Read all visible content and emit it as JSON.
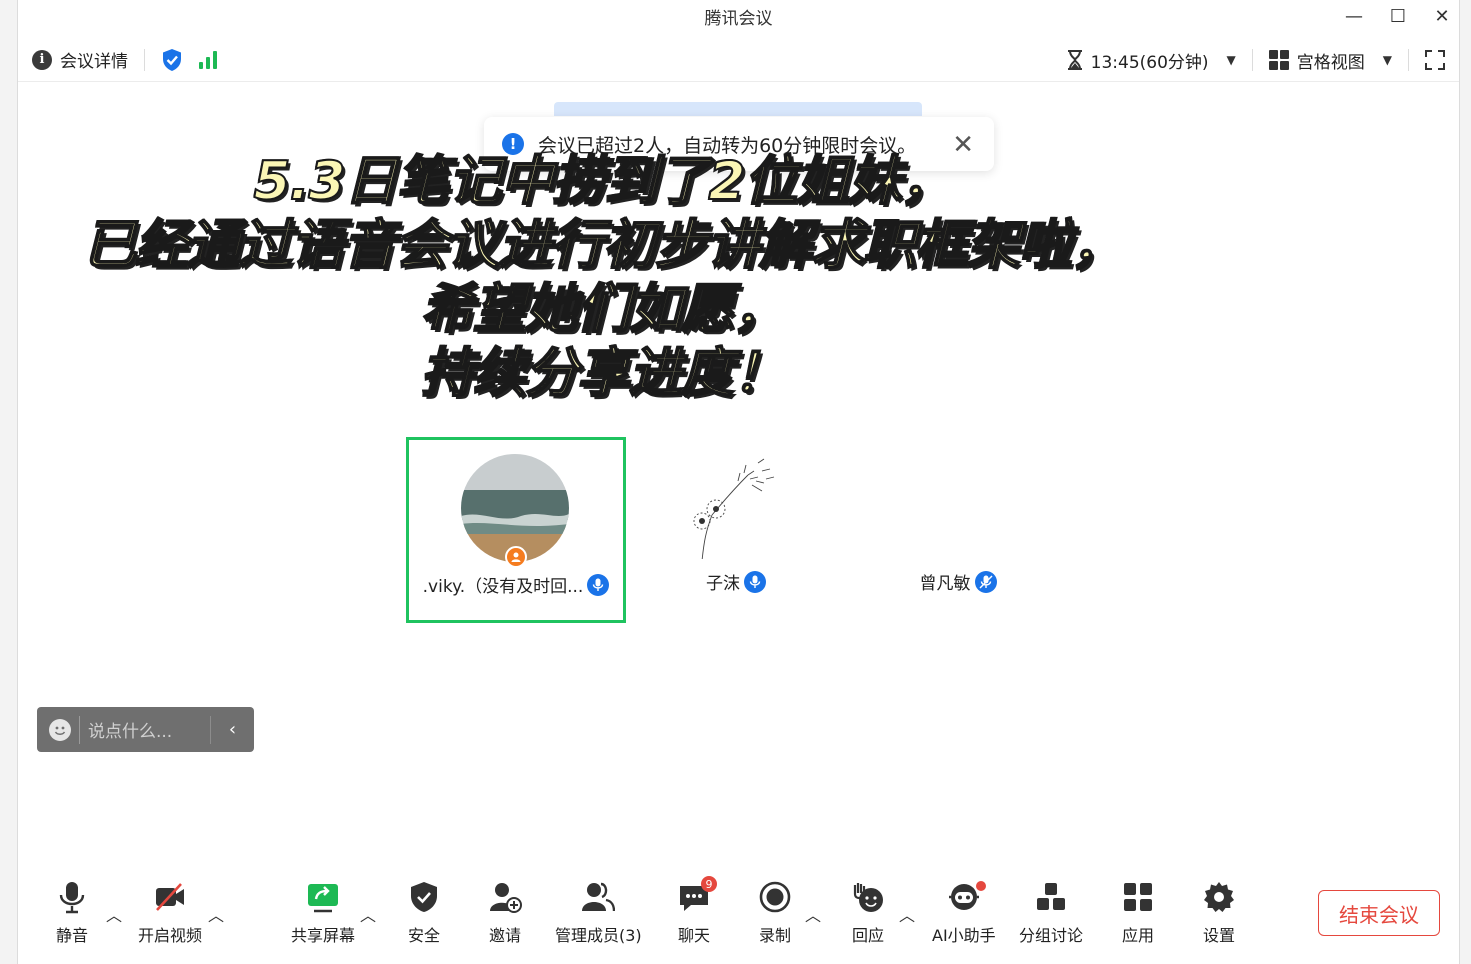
{
  "window": {
    "title": "腾讯会议"
  },
  "top_bar": {
    "meeting_details": "会议详情",
    "timer": "13:45(60分钟)",
    "view_mode": "宫格视图"
  },
  "toast": {
    "message": "会议已超过2人，自动转为60分钟限时会议。"
  },
  "overlay_text": {
    "line1": "5.3日笔记中捞到了2位姐妹，",
    "line2": "已经通过语音会议进行初步讲解求职框架啦，",
    "line3": "希望她们如愿，",
    "line4": "持续分享进度！"
  },
  "participants": [
    {
      "name": ".viky.（没有及时回...",
      "active": true
    },
    {
      "name": "子沫",
      "active": false
    },
    {
      "name": "曾凡敏",
      "active": false
    }
  ],
  "chat": {
    "placeholder": "说点什么..."
  },
  "toolbar": {
    "mute": "静音",
    "video": "开启视频",
    "share": "共享屏幕",
    "security": "安全",
    "invite": "邀请",
    "members": "管理成员(3)",
    "chat": "聊天",
    "chat_badge": "9",
    "record": "录制",
    "react": "回应",
    "ai": "AI小助手",
    "breakout": "分组讨论",
    "apps": "应用",
    "settings": "设置",
    "end": "结束会议"
  }
}
